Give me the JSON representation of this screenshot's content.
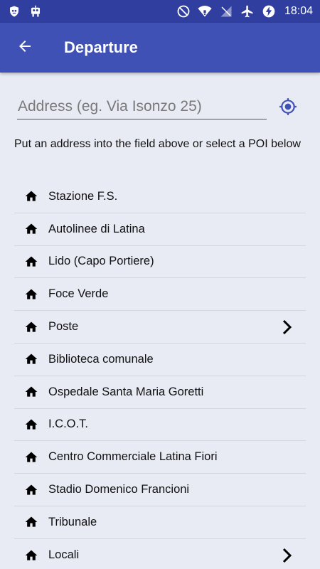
{
  "status_bar": {
    "time": "18:04",
    "left_icons": [
      "shield-icon",
      "robot-icon"
    ],
    "right_icons": [
      "do-not-disturb-icon",
      "wifi-icon",
      "no-signal-icon",
      "airplane-icon",
      "battery-charging-icon"
    ]
  },
  "app_bar": {
    "title": "Departure",
    "back_icon": "arrow-left-icon"
  },
  "search": {
    "placeholder": "Address (eg. Via Isonzo 25)",
    "value": ""
  },
  "hint": "Put an address into the field above or select a POI below",
  "poi_list": [
    {
      "label": "Stazione F.S.",
      "has_submenu": false
    },
    {
      "label": "Autolinee di Latina",
      "has_submenu": false
    },
    {
      "label": "Lido (Capo Portiere)",
      "has_submenu": false
    },
    {
      "label": "Foce Verde",
      "has_submenu": false
    },
    {
      "label": "Poste",
      "has_submenu": true
    },
    {
      "label": "Biblioteca comunale",
      "has_submenu": false
    },
    {
      "label": "Ospedale Santa Maria Goretti",
      "has_submenu": false
    },
    {
      "label": "I.C.O.T.",
      "has_submenu": false
    },
    {
      "label": "Centro Commerciale Latina Fiori",
      "has_submenu": false
    },
    {
      "label": "Stadio Domenico Francioni",
      "has_submenu": false
    },
    {
      "label": "Tribunale",
      "has_submenu": false
    },
    {
      "label": "Locali",
      "has_submenu": true
    }
  ],
  "colors": {
    "status_bar": "#303f9f",
    "app_bar": "#3f51b5",
    "background": "#e8eaf4",
    "accent": "#3f51b5"
  }
}
